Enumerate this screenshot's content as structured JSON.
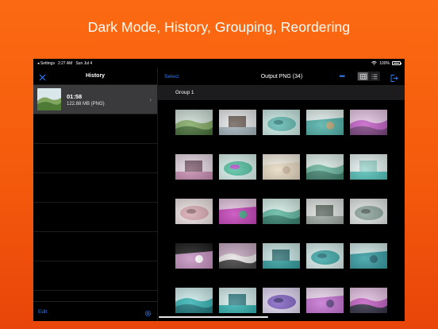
{
  "headline": "Dark Mode, History, Grouping, Reordering",
  "status": {
    "back_label": "◂ Settings",
    "time": "2:27 AM",
    "date": "Sun Jul 4",
    "battery": "100%"
  },
  "sidebar": {
    "title": "History",
    "items": [
      {
        "time": "01:58",
        "size": "122.88 MB (PNG)",
        "selected": true
      }
    ],
    "edit_label": "Edit"
  },
  "main": {
    "select_label": "Select",
    "title": "Output PNG (34)",
    "more_label": "•••",
    "group_label": "Group 1",
    "view_mode": "grid"
  },
  "colors": {
    "accent": "#2f7cf6",
    "background_top": "#fb6a12",
    "background_bottom": "#e8450a"
  },
  "thumbnails": [
    {
      "subject": "green hills",
      "c1": "#7fa860",
      "c2": "#3f6a30",
      "c3": "#cfe0d8"
    },
    {
      "subject": "mountain house",
      "c1": "#9fb0b8",
      "c2": "#5b4a3f",
      "c3": "#e6e8ea"
    },
    {
      "subject": "teal lake",
      "c1": "#5fb9b0",
      "c2": "#2f7f7a",
      "c3": "#c9e9e4"
    },
    {
      "subject": "coastal cliffs",
      "c1": "#4aaea5",
      "c2": "#b7a070",
      "c3": "#e4f1ee"
    },
    {
      "subject": "purple flowers",
      "c1": "#c25cc6",
      "c2": "#7a3e7e",
      "c3": "#e8c7e6"
    },
    {
      "subject": "ruins pink",
      "c1": "#c68ab0",
      "c2": "#6d4a5c",
      "c3": "#e7d8e4"
    },
    {
      "subject": "neon structure",
      "c1": "#4fbf9f",
      "c2": "#b14fc7",
      "c3": "#d8f0ea"
    },
    {
      "subject": "flower field",
      "c1": "#e6d9c0",
      "c2": "#c9b39a",
      "c3": "#f4ede1"
    },
    {
      "subject": "valley teal",
      "c1": "#66b29b",
      "c2": "#3b7d6a",
      "c3": "#dff0ea"
    },
    {
      "subject": "beach teal",
      "c1": "#4fc1b8",
      "c2": "#8fd0c8",
      "c3": "#e7f4f2"
    },
    {
      "subject": "pink grass",
      "c1": "#d7a8b0",
      "c2": "#8f6b70",
      "c3": "#efe3e4"
    },
    {
      "subject": "magenta tower",
      "c1": "#c43fb8",
      "c2": "#3a9f7f",
      "c3": "#e6c7e1"
    },
    {
      "subject": "koi fish",
      "c1": "#5bb7a0",
      "c2": "#2f7c6a",
      "c3": "#d7efe8"
    },
    {
      "subject": "panda enclosure",
      "c1": "#9aa59e",
      "c2": "#4e5a52",
      "c3": "#dde2df"
    },
    {
      "subject": "panda rocks",
      "c1": "#8aa39a",
      "c2": "#4f5e57",
      "c3": "#e1e7e4"
    },
    {
      "subject": "panda pink",
      "c1": "#c58fbf",
      "c2": "#ffffff",
      "c3": "#1a1a1a"
    },
    {
      "subject": "panda white",
      "c1": "#e9e5e6",
      "c2": "#3a3a3a",
      "c3": "#c5a8c0"
    },
    {
      "subject": "shark tank",
      "c1": "#2d9b9b",
      "c2": "#1a5f64",
      "c3": "#c7e6e4"
    },
    {
      "subject": "fish tank",
      "c1": "#3aa6a6",
      "c2": "#1d6c73",
      "c3": "#d5ecea"
    },
    {
      "subject": "aquarium",
      "c1": "#2f9aa0",
      "c2": "#18606a",
      "c3": "#d0e9e9"
    },
    {
      "subject": "turtle reef",
      "c1": "#2fb1b1",
      "c2": "#17747a",
      "c3": "#cfeeee"
    },
    {
      "subject": "fish teal",
      "c1": "#2fb0b0",
      "c2": "#1a6c74",
      "c3": "#d6efee"
    },
    {
      "subject": "fish purple",
      "c1": "#7f5fc2",
      "c2": "#3b2f73",
      "c3": "#e0d7f2"
    },
    {
      "subject": "sunset purple",
      "c1": "#c46fd2",
      "c2": "#5a3f80",
      "c3": "#f0d9f3"
    },
    {
      "subject": "skyline pink",
      "c1": "#c15bc0",
      "c2": "#2a2a3f",
      "c3": "#e8c3e6"
    }
  ]
}
